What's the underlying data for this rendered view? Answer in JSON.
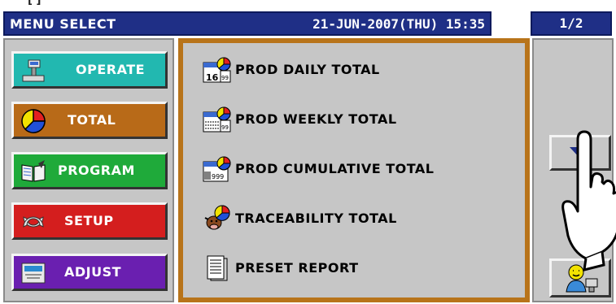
{
  "header": {
    "title": "MENU SELECT",
    "datetime": "21-JUN-2007(THU) 15:35",
    "page": "1/2"
  },
  "left_menu": [
    {
      "label": "OPERATE",
      "icon": "scale-icon",
      "color": "#22b8b0"
    },
    {
      "label": "TOTAL",
      "icon": "pie-chart-icon",
      "color": "#b86a18"
    },
    {
      "label": "PROGRAM",
      "icon": "book-icon",
      "color": "#1faa3a"
    },
    {
      "label": "SETUP",
      "icon": "wrench-icon",
      "color": "#d41e1e"
    },
    {
      "label": "ADJUST",
      "icon": "adjust-scale-icon",
      "color": "#6a1fb0"
    }
  ],
  "total_items": [
    {
      "label": "PROD DAILY TOTAL",
      "icon": "calendar-pie-icon"
    },
    {
      "label": "PROD WEEKLY TOTAL",
      "icon": "calendar-week-pie-icon"
    },
    {
      "label": "PROD CUMULATIVE TOTAL",
      "icon": "calendar-cumulative-pie-icon"
    },
    {
      "label": "TRACEABILITY TOTAL",
      "icon": "cow-pie-icon"
    },
    {
      "label": "PRESET REPORT",
      "icon": "document-icon"
    }
  ],
  "right_panel": {
    "down_icon": "triangle-down-icon",
    "user_icon": "operator-icon",
    "hand_icon": "pointing-hand-icon"
  },
  "colors": {
    "header_bg": "#1f2f86",
    "panel_bg": "#c6c6c6",
    "panel_border_active": "#b8741a"
  }
}
